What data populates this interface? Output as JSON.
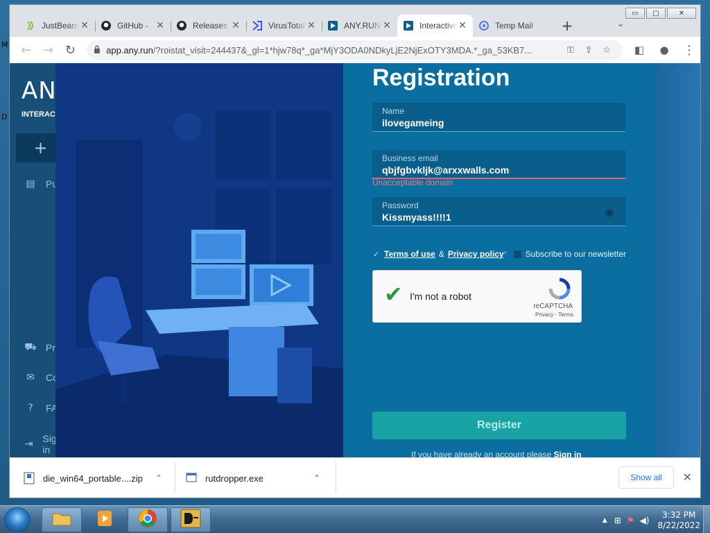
{
  "desktop": {
    "edge_labels": [
      "M",
      "D"
    ]
  },
  "window": {
    "minimize": "▭",
    "maximize": "▢",
    "close": "✕"
  },
  "tabs": [
    {
      "title": "JustBeam",
      "icon": "justbeam-icon",
      "active": false
    },
    {
      "title": "GitHub -",
      "icon": "github-icon",
      "active": false
    },
    {
      "title": "Releases",
      "icon": "github-icon",
      "active": false
    },
    {
      "title": "VirusTotal",
      "icon": "virustotal-icon",
      "active": false
    },
    {
      "title": "ANY.RUN",
      "icon": "anyrun-icon",
      "active": false
    },
    {
      "title": "Interactive",
      "icon": "anyrun-icon",
      "active": true
    },
    {
      "title": "Temp Mail",
      "icon": "tempmail-icon",
      "active": false
    }
  ],
  "new_tab_symbol": "+",
  "tab_search_symbol": "⌄",
  "toolbar": {
    "back": "←",
    "forward": "→",
    "reload": "↻",
    "url_domain": "app.any.run",
    "url_rest": "/?roistat_visit=244437&_gl=1*hjw78q*_ga*MjY3ODA0NDkyLjE2NjExOTY3MDA.*_ga_53KB7...",
    "key_symbol": "⚿",
    "share_symbol": "⇪",
    "bookmark_symbol": "☆",
    "sidepanel_symbol": "◧",
    "profile_symbol": "●",
    "menu_symbol": "⋮"
  },
  "app_sidebar": {
    "brand": "ANY.RUN",
    "brand_sub": "INTERACTIVE",
    "new_task_symbol": "+",
    "items": [
      {
        "label": "Public",
        "icon": "document-icon",
        "symbol": "▤"
      },
      {
        "label": "Pricing",
        "icon": "cart-icon",
        "symbol": "⛟"
      },
      {
        "label": "Contacts",
        "icon": "mail-icon",
        "symbol": "✉"
      },
      {
        "label": "FAQ",
        "icon": "help-icon",
        "symbol": "?"
      },
      {
        "label": "Sign in",
        "icon": "signin-icon",
        "symbol": "⇥"
      }
    ]
  },
  "registration": {
    "title": "Registration",
    "name": {
      "label": "Name",
      "value": "ilovegameing"
    },
    "email": {
      "label": "Business email",
      "value": "qbjfgbvkljk@arxxwalls.com",
      "error": "Unacceptable domain"
    },
    "password": {
      "label": "Password",
      "value": "Kissmyass!!!!1"
    },
    "eye_symbol": "◉",
    "check_symbol": "✓",
    "terms_label": "Terms of use",
    "amp": "&",
    "privacy_label": "Privacy policy",
    "required_mark": "*",
    "newsletter_label": "Subscribe to our newsletter",
    "captcha": {
      "check_symbol": "✔",
      "label": "I'm not a robot",
      "brand": "reCAPTCHA",
      "links": "Privacy - Terms"
    },
    "register_label": "Register",
    "signin_prompt": "If you have already an account please",
    "signin_link": "Sign in"
  },
  "downloads": {
    "items": [
      {
        "name": "die_win64_portable....zip",
        "icon": "zip-file-icon"
      },
      {
        "name": "rutdropper.exe",
        "icon": "exe-file-icon"
      }
    ],
    "chevron": "⌃",
    "show_all": "Show all",
    "close": "✕"
  },
  "taskbar": {
    "tray_up": "▲",
    "network_symbol": "⊞",
    "flag_symbol": "⚑",
    "volume_symbol": "◀)",
    "time": "3:32 PM",
    "date": "8/22/2022"
  },
  "colors": {
    "accent_teal": "#1aa3a4",
    "error": "#e87b84",
    "panel": "#0a6fa0",
    "link_blue": "#1a73e8"
  }
}
